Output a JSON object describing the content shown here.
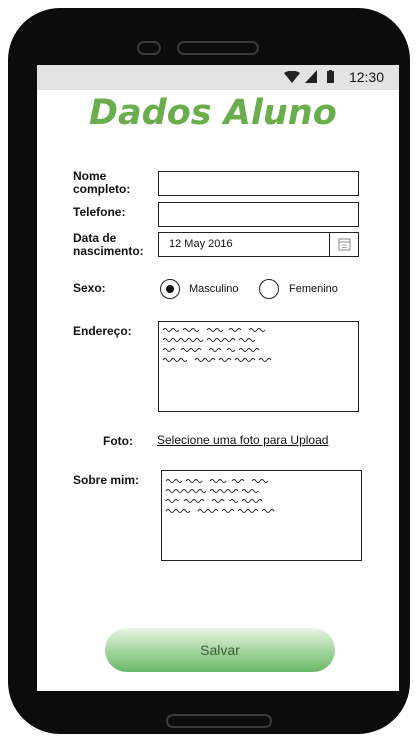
{
  "status_bar": {
    "time": "12:30",
    "icons": [
      "wifi-icon",
      "signal-icon",
      "battery-icon"
    ]
  },
  "header": {
    "title": "Dados Aluno"
  },
  "form": {
    "nome_label_line1": "Nome",
    "nome_label_line2": "completo:",
    "nome_value": "",
    "telefone_label": "Telefone:",
    "telefone_value": "",
    "nascimento_label_line1": "Data de",
    "nascimento_label_line2": "nascimento:",
    "nascimento_value": "12 May 2016",
    "sexo_label": "Sexo:",
    "sexo_options": [
      "Masculino",
      "Femenino"
    ],
    "sexo_selected": "Masculino",
    "endereco_label": "Endereço:",
    "foto_label": "Foto:",
    "foto_link": "Selecione uma foto para Upload",
    "sobre_label": "Sobre mim:"
  },
  "actions": {
    "save_label": "Salvar"
  },
  "colors": {
    "title_green": "#6aad4d",
    "button_green": "#69b866"
  }
}
